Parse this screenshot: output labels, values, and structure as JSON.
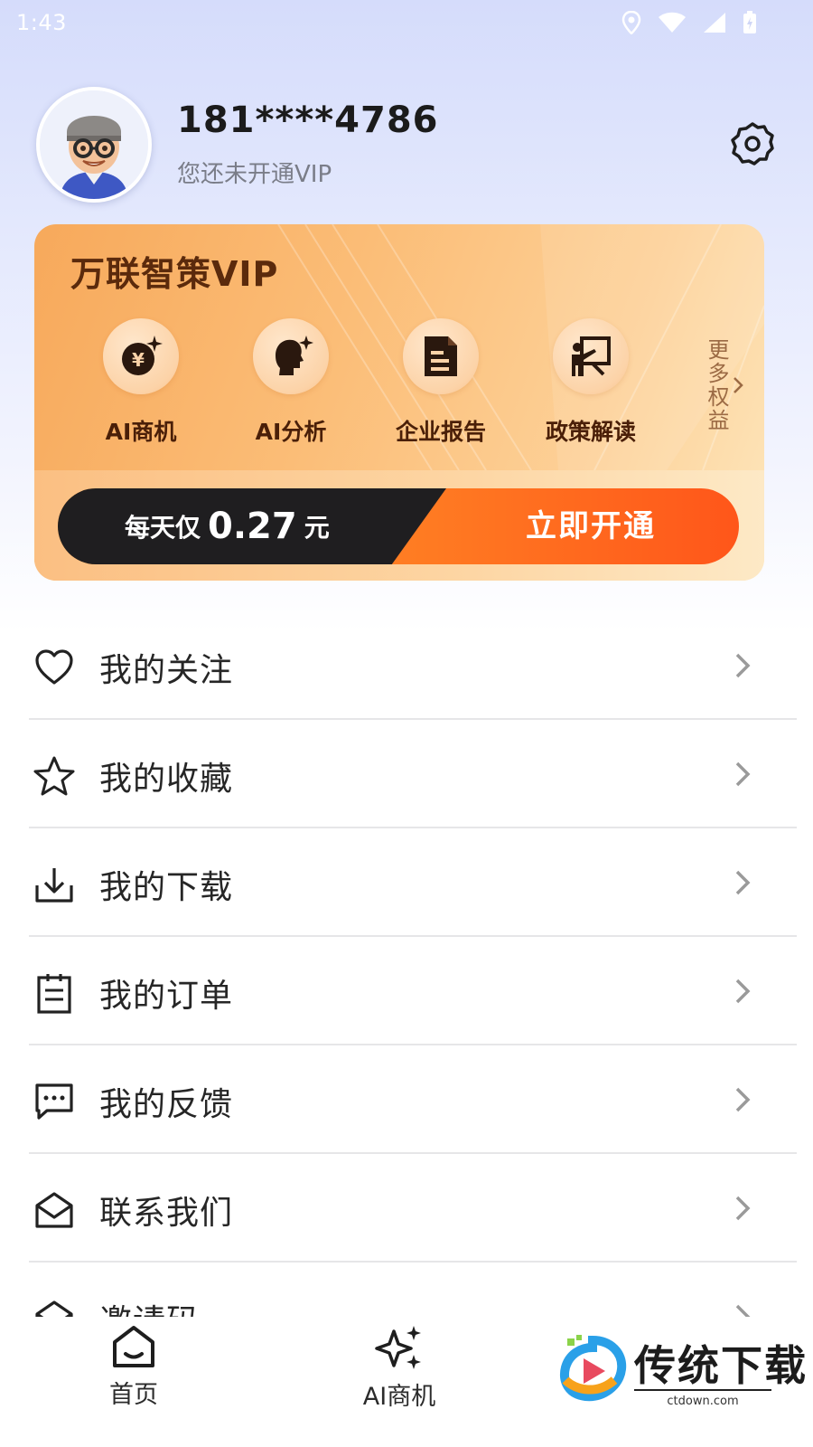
{
  "status_bar": {
    "time": "1:43"
  },
  "profile": {
    "phone": "181****4786",
    "vip_status": "您还未开通VIP"
  },
  "vip_card": {
    "title": "万联智策VIP",
    "benefits": [
      {
        "label": "AI商机",
        "icon": "coin-sparkle-icon"
      },
      {
        "label": "AI分析",
        "icon": "head-sparkle-icon"
      },
      {
        "label": "企业报告",
        "icon": "document-icon"
      },
      {
        "label": "政策解读",
        "icon": "presenter-icon"
      }
    ],
    "more": "更多权益",
    "price_prefix": "每天仅",
    "price_value": "0.27",
    "price_unit": "元",
    "cta": "立即开通",
    "colors": {
      "card": "#fbbd77",
      "cta_start": "#ff9a2e",
      "cta_end": "#ff561a",
      "dark": "#1f1e20"
    }
  },
  "menu": [
    {
      "label": "我的关注",
      "icon": "heart-icon"
    },
    {
      "label": "我的收藏",
      "icon": "star-icon"
    },
    {
      "label": "我的下载",
      "icon": "download-icon"
    },
    {
      "label": "我的订单",
      "icon": "clipboard-icon"
    },
    {
      "label": "我的反馈",
      "icon": "chat-icon"
    },
    {
      "label": "联系我们",
      "icon": "mail-icon"
    },
    {
      "label": "邀请码",
      "icon": "envelope-icon"
    }
  ],
  "tabbar": {
    "tabs": [
      {
        "label": "首页",
        "icon": "home-icon"
      },
      {
        "label": "AI商机",
        "icon": "sparkle-icon"
      }
    ],
    "watermark": {
      "text": "传统下载",
      "url": "ctdown.com"
    }
  }
}
